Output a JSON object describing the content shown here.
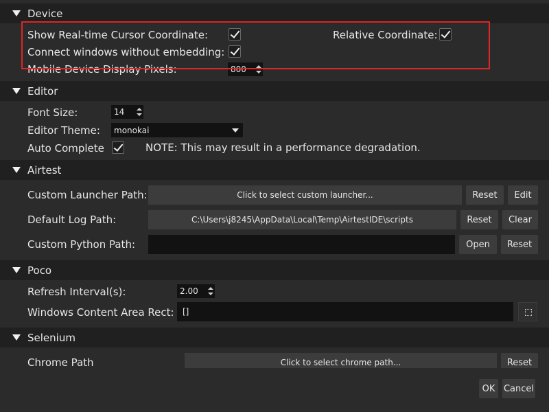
{
  "sections": {
    "device": "Device",
    "editor": "Editor",
    "airtest": "Airtest",
    "poco": "Poco",
    "selenium": "Selenium"
  },
  "device": {
    "show_cursor_label": "Show Real-time Cursor Coordinate:",
    "show_cursor_checked": true,
    "relative_label": "Relative Coordinate:",
    "relative_checked": true,
    "connect_label": "Connect windows without embedding:",
    "connect_checked": true,
    "mobile_pixels_label": "Mobile Device Display Pixels:",
    "mobile_pixels_value": "800"
  },
  "editor": {
    "font_size_label": "Font Size:",
    "font_size_value": "14",
    "theme_label": "Editor Theme:",
    "theme_value": "monokai",
    "auto_complete_label": "Auto Complete",
    "auto_complete_checked": true,
    "note": "NOTE: This may result in a performance degradation."
  },
  "airtest": {
    "launcher_label": "Custom Launcher Path:",
    "launcher_value": "Click to select custom launcher...",
    "launcher_reset": "Reset",
    "launcher_edit": "Edit",
    "log_label": "Default Log Path:",
    "log_value": "C:\\Users\\j8245\\AppData\\Local\\Temp\\AirtestIDE\\scripts",
    "log_reset": "Reset",
    "log_clear": "Clear",
    "python_label": "Custom Python Path:",
    "python_value": "",
    "python_open": "Open",
    "python_reset": "Reset"
  },
  "poco": {
    "refresh_label": "Refresh Interval(s):",
    "refresh_value": "2.00",
    "rect_label": "Windows Content Area Rect:",
    "rect_value": "[]"
  },
  "selenium": {
    "chrome_label": "Chrome Path",
    "chrome_value": "Click to select chrome path...",
    "chrome_reset": "Reset"
  },
  "footer": {
    "ok": "OK",
    "cancel": "Cancel"
  },
  "colors": {
    "background": "#2b2b2b",
    "header": "#202020",
    "highlight": "#e02525"
  },
  "icons": [
    "expand-triangle-icon",
    "checkmark-icon",
    "spin-arrows-icon",
    "dropdown-caret-icon",
    "select-area-icon"
  ]
}
